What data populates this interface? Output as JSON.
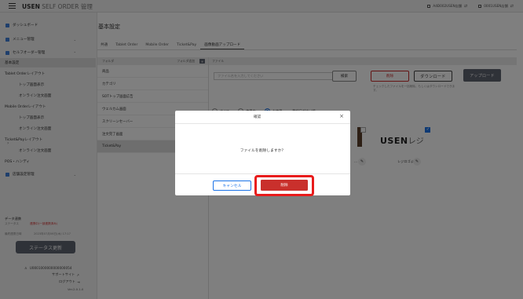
{
  "topbar": {
    "brand_bold": "USEN",
    "brand_rest": " SELF ORDER 管理",
    "store_name": "A4Ð002USEN店舗",
    "store_id": "0001USEN店舗"
  },
  "sidebar": {
    "items": [
      {
        "label": "ダッシュボード",
        "icon_color": "#3f7fd8"
      },
      {
        "label": "メニュー管理",
        "icon_color": "#3f7fd8",
        "chevron": "⌄"
      },
      {
        "label": "セルフオーダー管理",
        "icon_color": "#3f7fd8",
        "chevron": "⌃"
      }
    ],
    "sub_items": [
      {
        "label": "基本設定",
        "active": true
      },
      {
        "label": "Tablet Orderレイアウト"
      },
      {
        "label": "トップ画面表示"
      },
      {
        "label": "オンライン注文画面"
      },
      {
        "label": "Mobile Orderレイアウト"
      },
      {
        "label": "トップ画面表示"
      },
      {
        "label": "オンライン注文画面"
      },
      {
        "label": "Ticket&Payレイアウト"
      },
      {
        "label": "オンライン注文画面"
      },
      {
        "label": "POS・ハンディ"
      }
    ],
    "store_mgmt": {
      "label": "店舗設定管理",
      "chevron": "⌄"
    },
    "data_label": "データ連携",
    "status_label": "ステータス",
    "status_value": "連携中(一部連携済み)",
    "update_label": "最終連携日時",
    "update_value": "2023年07月06日(木) 17:17",
    "status_button": "ステータス更新",
    "account_id": "U0001000000000000054",
    "support": "サポートサイト",
    "logout": "ログアウト",
    "version": "Ver.2.0.1.0"
  },
  "main": {
    "title": "基本設定",
    "tabs": [
      {
        "label": "共通"
      },
      {
        "label": "Tablet Order"
      },
      {
        "label": "Mobile Order"
      },
      {
        "label": "Ticket&Pay"
      },
      {
        "label": "画像動画アップロード",
        "active": true
      }
    ],
    "folder_header": "フォルダ",
    "folder_add": "フォルダ追加",
    "folder_add_icon": "+",
    "folders": [
      {
        "label": "商品"
      },
      {
        "label": "カテゴリ"
      },
      {
        "label": "SOTトップ画面広告"
      },
      {
        "label": "ウェルカム画面"
      },
      {
        "label": "スクリーンセーバー"
      },
      {
        "label": "注文完了画面"
      },
      {
        "label": "Ticket&Pay",
        "active": true
      }
    ],
    "file_header": "ファイル",
    "search_placeholder": "ファイル名を入力してください",
    "search_button": "検索",
    "delete_button": "削除",
    "download_button": "ダウンロード",
    "upload_button": "アップロード",
    "download_note": "チェックしたファイルを一括削除、もしくはダウンロードできます。",
    "filters": [
      {
        "label": "すべて"
      },
      {
        "label": "使用中"
      },
      {
        "label": "未使用",
        "selected": true
      }
    ],
    "sort_label": "登録日が古い順",
    "usen_logo": "USEN",
    "usen_logo_suffix": "レジ",
    "file1_suffix": "...",
    "file2_name": "レジロゴ.png"
  },
  "modal": {
    "title": "確認",
    "message": "ファイルを削除しますか？",
    "cancel": "キャンセル",
    "confirm": "削除"
  }
}
